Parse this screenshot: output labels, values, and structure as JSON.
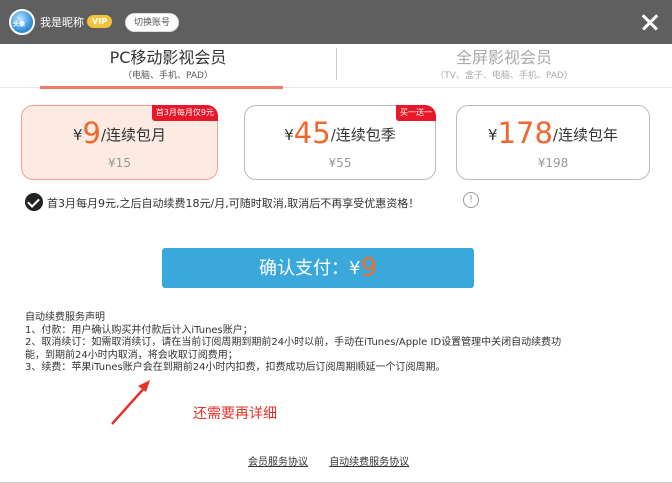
{
  "titlebar": {
    "nickname": "我是昵称",
    "vip_badge": "VIP",
    "switch_label": "切换账号",
    "avatar_tag": "头像"
  },
  "tabs": [
    {
      "label": "PC移动影视会员",
      "sub": "（电脑、手机、PAD）"
    },
    {
      "label": "全屏影视会员",
      "sub": "（TV、盒子、电脑、手机、PAD）"
    }
  ],
  "plans": [
    {
      "yen": "¥",
      "price": "9",
      "unit": "/连续包月",
      "original": "¥15",
      "ribbon": "首3月每月仅9元"
    },
    {
      "yen": "¥",
      "price": "45",
      "unit": "/连续包季",
      "original": "¥55",
      "ribbon": "买一送一"
    },
    {
      "yen": "¥",
      "price": "178",
      "unit": "/连续包年",
      "original": "¥198",
      "ribbon": ""
    }
  ],
  "notice": "首3月每月9元,之后自动续费18元/月,可随时取消,取消后不再享受优惠资格！",
  "info_glyph": "!",
  "pay": {
    "label": "确认支付：¥",
    "amount": "9"
  },
  "terms": [
    "自动续费服务声明",
    "1、付款：用户确认购买并付款后计入iTunes账户；",
    "2、取消续订：如需取消续订，请在当前订阅周期到期前24小时以前，手动在iTunes/Apple ID设置管理中关闭自动续费功",
    "能，到期前24小时内取消，将会收取订阅费用；",
    "3、续费：苹果iTunes账户会在到期前24小时内扣费，扣费成功后订阅周期顺延一个订阅周期。"
  ],
  "annotation": "还需要再详细",
  "links": [
    "会员服务协议",
    "自动续费服务协议"
  ]
}
